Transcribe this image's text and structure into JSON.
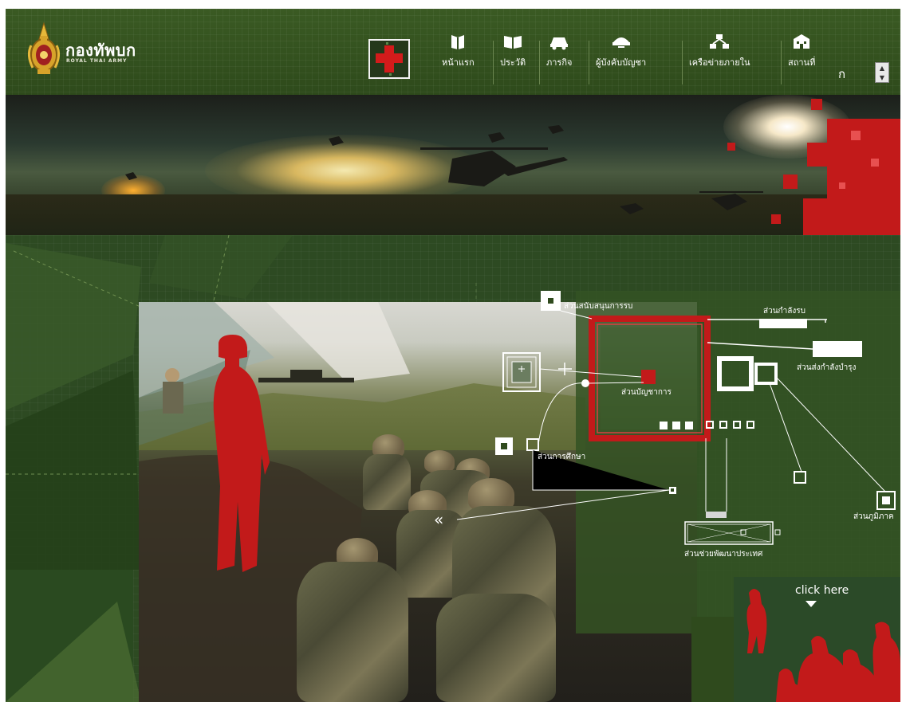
{
  "header": {
    "logo_text_th": "กองทัพบก",
    "logo_text_en": "ROYAL THAI ARMY"
  },
  "nav": {
    "items": [
      {
        "label": "หน้าแรก",
        "icon": "book-icon"
      },
      {
        "label": "ประวัติ",
        "icon": "open-book-icon"
      },
      {
        "label": "ภารกิจ",
        "icon": "vehicle-icon"
      },
      {
        "label": "ผู้บังคับบัญชา",
        "icon": "officer-cap-icon"
      },
      {
        "label": "เครือข่ายภายใน",
        "icon": "network-icon"
      },
      {
        "label": "สถานที่",
        "icon": "building-icon"
      }
    ],
    "font_size_label": "ก"
  },
  "diagram": {
    "labels": {
      "combat_support": "ส่วนสนับสนุนการรบ",
      "combat_force": "ส่วนกำลังรบ",
      "service_support": "ส่วนส่งกำลังบำรุง",
      "command": "ส่วนบัญชาการ",
      "education": "ส่วนการศึกษา",
      "regional": "ส่วนภูมิภาค",
      "development": "ส่วนช่วยพัฒนาประเทศ"
    }
  },
  "click_here": "click here",
  "colors": {
    "primary_green": "#2f4a1d",
    "accent_red": "#c21a1a",
    "line_white": "#ffffff"
  }
}
